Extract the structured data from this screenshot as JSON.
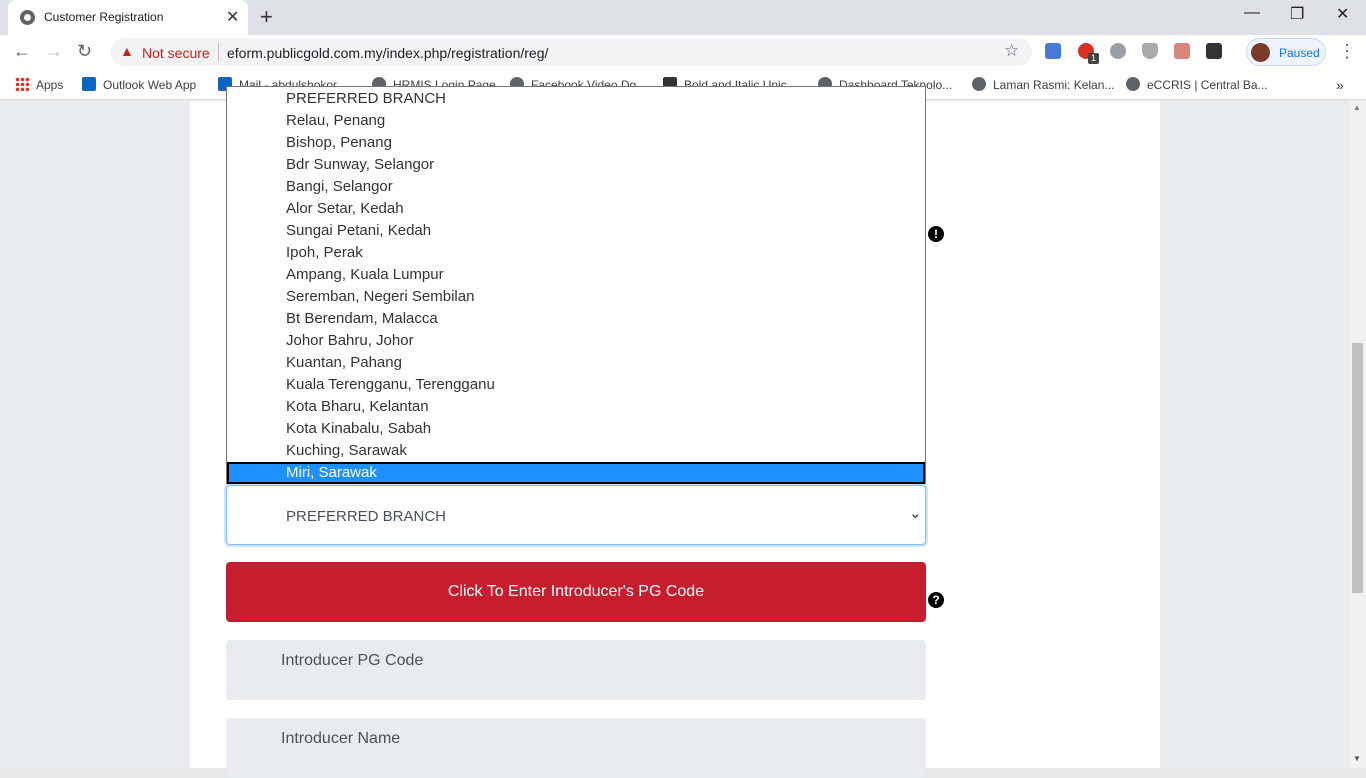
{
  "browser": {
    "tab_title": "Customer Registration",
    "security_label": "Not secure",
    "url": "eform.publicgold.com.my/index.php/registration/reg/",
    "profile_status": "Paused",
    "extension_badge": "1"
  },
  "bookmarks": [
    {
      "label": "Apps",
      "icon": "apps-icon"
    },
    {
      "label": "Outlook Web App",
      "icon": "outlook-icon"
    },
    {
      "label": "Mail - abdulshokor...",
      "icon": "mail-icon"
    },
    {
      "label": "HRMIS Login Page",
      "icon": "globe-icon"
    },
    {
      "label": "Facebook Video Do...",
      "icon": "globe-icon"
    },
    {
      "label": "Bold and Italic Unic...",
      "icon": "yaytext-icon"
    },
    {
      "label": "Dashboard Teknolo...",
      "icon": "globe-icon"
    },
    {
      "label": "Laman Rasmi: Kelan...",
      "icon": "globe-icon"
    },
    {
      "label": "eCCRIS | Central Ba...",
      "icon": "globe-icon"
    }
  ],
  "form": {
    "branch_select": {
      "selected": "PREFERRED BRANCH",
      "highlighted": "Miri, Sarawak",
      "options": [
        "PREFERRED BRANCH",
        "Relau, Penang",
        "Bishop, Penang",
        "Bdr Sunway, Selangor",
        "Bangi, Selangor",
        "Alor Setar, Kedah",
        "Sungai Petani, Kedah",
        "Ipoh, Perak",
        "Ampang, Kuala Lumpur",
        "Seremban, Negeri Sembilan",
        "Bt Berendam, Malacca",
        "Johor Bahru, Johor",
        "Kuantan, Pahang",
        "Kuala Terengganu, Terengganu",
        "Kota Bharu, Kelantan",
        "Kota Kinabalu, Sabah",
        "Kuching, Sarawak",
        "Miri, Sarawak"
      ]
    },
    "introducer_button": "Click To Enter Introducer's PG Code",
    "introducer_code_placeholder": "Introducer PG Code",
    "introducer_name_placeholder": "Introducer Name"
  },
  "colors": {
    "accent_red": "#c61e2e",
    "highlight_blue": "#1e90ff"
  }
}
